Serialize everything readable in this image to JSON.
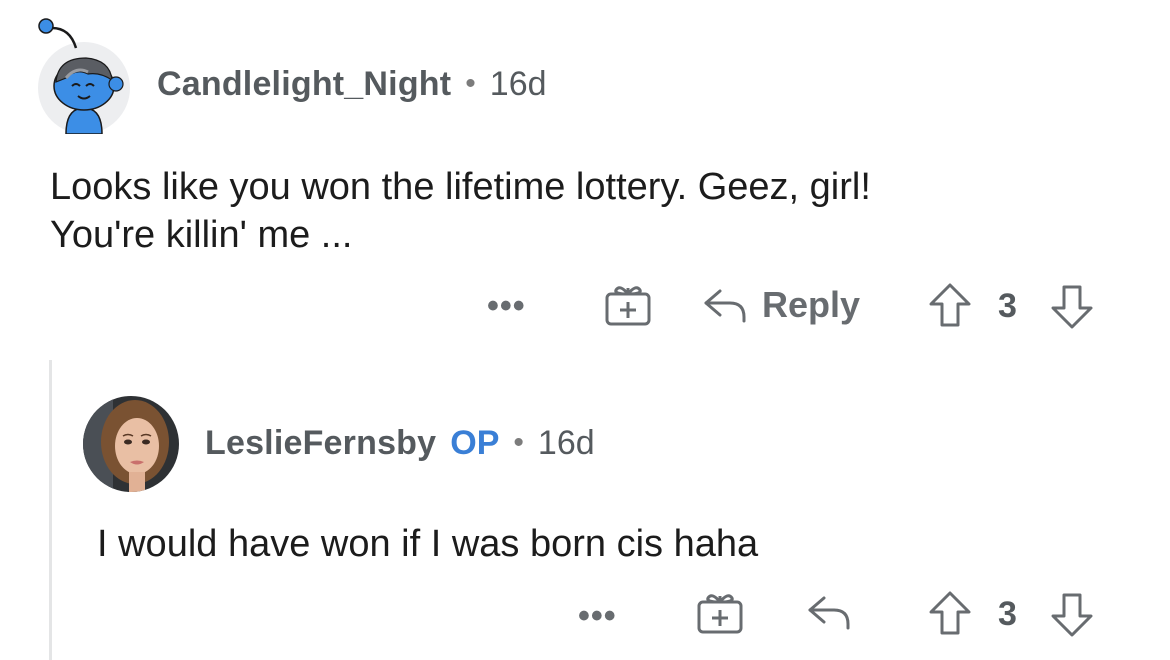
{
  "comments": [
    {
      "username": "Candlelight_Night",
      "separator": "•",
      "age": "16d",
      "body": "Looks like you won the lifetime lottery. Geez, girl!\nYou're killin' me ...",
      "actions": {
        "more": "•••",
        "reply_label": "Reply",
        "score": "3"
      },
      "avatar_icon": "reddit-snoo-avatar-icon"
    },
    {
      "username": "LeslieFernsby",
      "op_badge": "OP",
      "separator": "•",
      "age": "16d",
      "body": "I would have won if I was born cis haha",
      "actions": {
        "more": "•••",
        "score": "3"
      },
      "avatar_icon": "user-portrait-avatar"
    }
  ],
  "colors": {
    "meta_gray": "#555a5e",
    "action_gray": "#686c70",
    "op_blue": "#3a7fd6",
    "snoo_blue": "#3c8ee6",
    "thread_line": "#e4e5e6"
  }
}
